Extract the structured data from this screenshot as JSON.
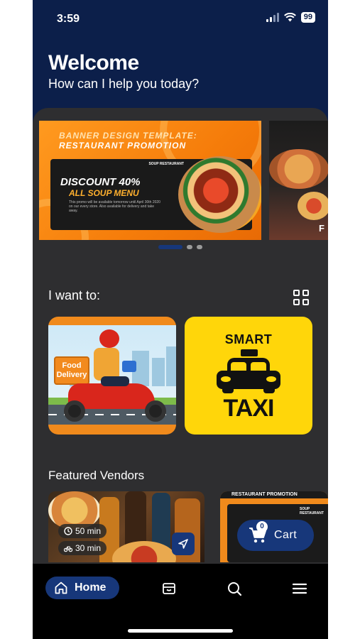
{
  "status_bar": {
    "time": "3:59",
    "battery": "99"
  },
  "header": {
    "title": "Welcome",
    "subtitle": "How can I help you today?"
  },
  "banners": [
    {
      "heading1": "BANNER DESIGN TEMPLATE:",
      "heading2": "RESTAURANT PROMOTION",
      "tag": "SOUP RESTAURANT",
      "discount": "DISCOUNT 40%",
      "menu": "ALL SOUP MENU",
      "fine_print": "This promo will be available tomorrow until April 30th 2020 on our every store. Also available for delivery and take away."
    },
    {
      "partial_letter": "F"
    }
  ],
  "carousel": {
    "active_index": 0,
    "count": 3
  },
  "services": {
    "title": "I want to:",
    "food": {
      "sign": "Food Delivery"
    },
    "taxi": {
      "top": "SMART",
      "bottom": "TAXI"
    }
  },
  "vendors": {
    "title": "Featured Vendors",
    "items": [
      {
        "time1": "50 min",
        "time2": "30 min"
      },
      {
        "header": "RESTAURANT PROMOTION",
        "tag": "SOUP RESTAURANT"
      }
    ]
  },
  "cart": {
    "label": "Cart",
    "count": "0"
  },
  "nav": {
    "home_label": "Home"
  },
  "colors": {
    "primary": "#17377a",
    "header_bg": "#0c1f4a",
    "surface": "#2e2e30",
    "taxi_yellow": "#ffd60a",
    "orange": "#f08a1c"
  },
  "icons": [
    "home-icon",
    "bag-icon",
    "search-icon",
    "menu-icon",
    "grid-icon",
    "clock-icon",
    "bike-icon",
    "navigate-icon",
    "cart-icon",
    "wifi-icon",
    "signal-icon"
  ]
}
